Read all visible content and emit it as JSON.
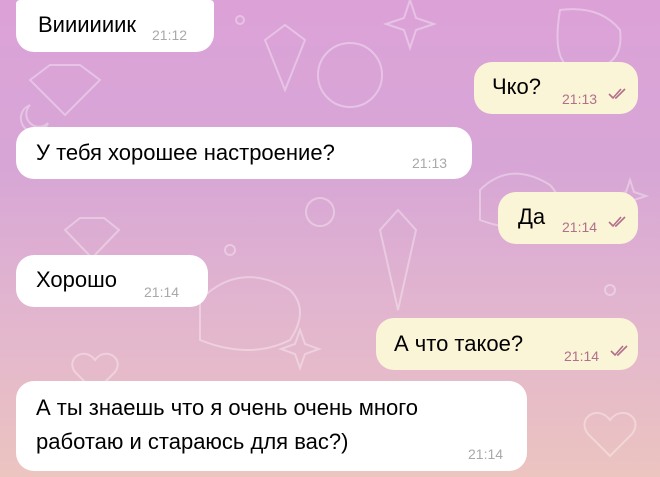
{
  "chat": {
    "messages": [
      {
        "direction": "in",
        "text": "Виииииик",
        "time": "21:12"
      },
      {
        "direction": "out",
        "text": "Чко?",
        "time": "21:13",
        "status": "read"
      },
      {
        "direction": "in",
        "text": "У тебя хорошее настроение?",
        "time": "21:13"
      },
      {
        "direction": "out",
        "text": "Да",
        "time": "21:14",
        "status": "read"
      },
      {
        "direction": "in",
        "text": "Хорошо",
        "time": "21:14"
      },
      {
        "direction": "out",
        "text": "А что такое?",
        "time": "21:14",
        "status": "read"
      },
      {
        "direction": "in",
        "text_lines": [
          "А ты знаешь что я очень очень много",
          "работаю и стараюсь для вас?)"
        ],
        "time": "21:14"
      }
    ]
  },
  "icons": {
    "read_status": "double-check-icon",
    "wallpaper": "doodle-wallpaper"
  },
  "colors": {
    "incoming_bubble": "#ffffff",
    "outgoing_bubble": "#fbf5d8",
    "outgoing_time": "#b26e8a",
    "incoming_time": "#a9a9ad"
  }
}
